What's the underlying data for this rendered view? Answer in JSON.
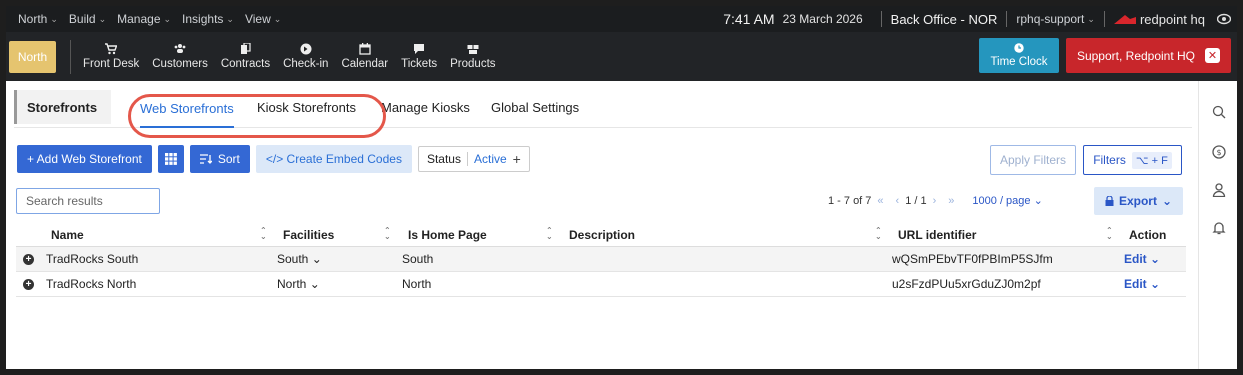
{
  "top_bar": {
    "menus": [
      "North",
      "Build",
      "Manage",
      "Insights",
      "View"
    ],
    "time": "7:41 AM",
    "date": "23 March 2026",
    "office": "Back Office - NOR",
    "account": "rphq-support",
    "brand": "redpoint hq"
  },
  "nav": {
    "location": "North",
    "items": [
      {
        "label": "Front Desk",
        "icon": "cart-icon"
      },
      {
        "label": "Customers",
        "icon": "people-icon"
      },
      {
        "label": "Contracts",
        "icon": "contract-icon"
      },
      {
        "label": "Check-in",
        "icon": "arrow-circle-icon"
      },
      {
        "label": "Calendar",
        "icon": "calendar-icon"
      },
      {
        "label": "Tickets",
        "icon": "chat-icon"
      },
      {
        "label": "Products",
        "icon": "products-icon"
      }
    ],
    "time_clock": "Time Clock",
    "support": "Support, Redpoint HQ"
  },
  "tabs": {
    "root": "Storefronts",
    "items": [
      "Web Storefronts",
      "Kiosk Storefronts",
      "Manage Kiosks",
      "Global Settings"
    ],
    "active": "Web Storefronts"
  },
  "toolbar": {
    "add": "+ Add Web Storefront",
    "sort": "Sort",
    "embed": "</> Create Embed Codes",
    "status_label": "Status",
    "status_value": "Active",
    "apply_filters": "Apply Filters",
    "filters": "Filters",
    "filters_shortcut": "⌥ + F"
  },
  "search": {
    "placeholder": "Search results"
  },
  "pager": {
    "range": "1 - 7 of 7",
    "page": "1 / 1",
    "per_page": "1000 / page",
    "export": "Export"
  },
  "table": {
    "columns": [
      "Name",
      "Facilities",
      "Is Home Page",
      "Description",
      "URL identifier",
      "Action"
    ],
    "rows": [
      {
        "name": "TradRocks South",
        "facilities": "South",
        "home_page": "South",
        "description": "",
        "url": "wQSmPEbvTF0fPBImP5SJfm",
        "action": "Edit"
      },
      {
        "name": "TradRocks North",
        "facilities": "North",
        "home_page": "North",
        "description": "",
        "url": "u2sFzdPUu5xrGduZJ0m2pf",
        "action": "Edit"
      }
    ]
  },
  "colors": {
    "accent": "#2a6fd6",
    "location": "#e5c46f",
    "time_clock": "#2596be",
    "support": "#c8262b",
    "annotation": "#e4574a"
  }
}
